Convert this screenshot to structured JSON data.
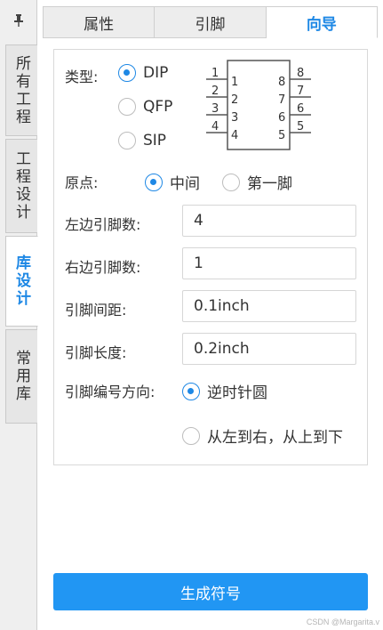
{
  "side_tabs": [
    {
      "label": "所有工程"
    },
    {
      "label": "工程设计"
    },
    {
      "label": "库设计"
    },
    {
      "label": "常用库"
    }
  ],
  "pin_icon": "pushpin-icon",
  "tabs": [
    {
      "label": "属性"
    },
    {
      "label": "引脚"
    },
    {
      "label": "向导"
    }
  ],
  "form": {
    "type_label": "类型:",
    "type_options": [
      "DIP",
      "QFP",
      "SIP"
    ],
    "type_selected": "DIP",
    "origin_label": "原点:",
    "origin_options": [
      "中间",
      "第一脚"
    ],
    "origin_selected": "中间",
    "left_pins_label": "左边引脚数:",
    "left_pins": "4",
    "right_pins_label": "右边引脚数:",
    "right_pins": "1",
    "pitch_label": "引脚间距:",
    "pitch": "0.1inch",
    "length_label": "引脚长度:",
    "length": "0.2inch",
    "numbering_label": "引脚编号方向:",
    "numbering_options": [
      "逆时针圆",
      "从左到右，从上到下"
    ],
    "numbering_selected": "逆时针圆"
  },
  "preview": {
    "left_outer": [
      "1",
      "2",
      "3",
      "4"
    ],
    "left_inner": [
      "1",
      "2",
      "3",
      "4"
    ],
    "right_inner": [
      "8",
      "7",
      "6",
      "5"
    ],
    "right_outer": [
      "8",
      "7",
      "6",
      "5"
    ]
  },
  "generate_button": "生成符号",
  "watermark": "CSDN @Margarita.v"
}
